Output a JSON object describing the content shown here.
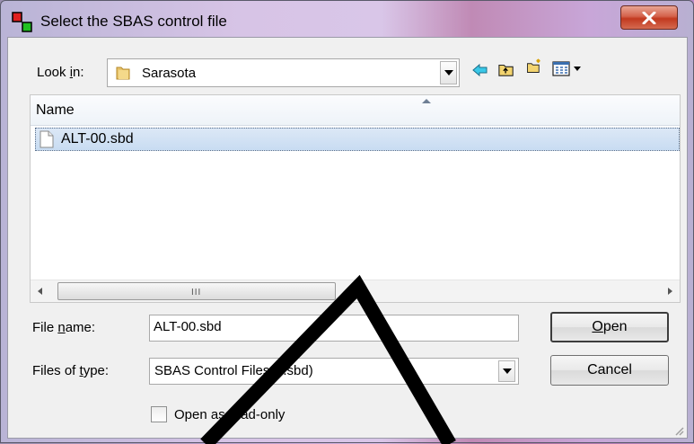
{
  "window": {
    "title": "Select the SBAS control file",
    "close_label": "X"
  },
  "lookin": {
    "label_pre": "Look ",
    "label_key": "i",
    "label_post": "n:",
    "value": "Sarasota"
  },
  "toolbar": {
    "icons": [
      "back-icon",
      "up-folder-icon",
      "new-folder-icon",
      "view-menu-icon"
    ]
  },
  "filelist": {
    "column_header": "Name",
    "files": [
      {
        "name": "ALT-00.sbd",
        "selected": true
      }
    ],
    "scroll_grip": "III"
  },
  "filename": {
    "label_pre": "File ",
    "label_key": "n",
    "label_post": "ame:",
    "value": "ALT-00.sbd"
  },
  "filetype": {
    "label_pre": "Files of ",
    "label_key": "t",
    "label_post": "ype:",
    "value": "SBAS Control Files (*.sbd)"
  },
  "readonly": {
    "label_pre": "Open as ",
    "label_key": "r",
    "label_post": "ead-only",
    "checked": false
  },
  "buttons": {
    "open_key": "O",
    "open_rest": "pen",
    "cancel": "Cancel"
  },
  "colors": {
    "selection": "#cde0f5",
    "close": "#c7442a"
  }
}
